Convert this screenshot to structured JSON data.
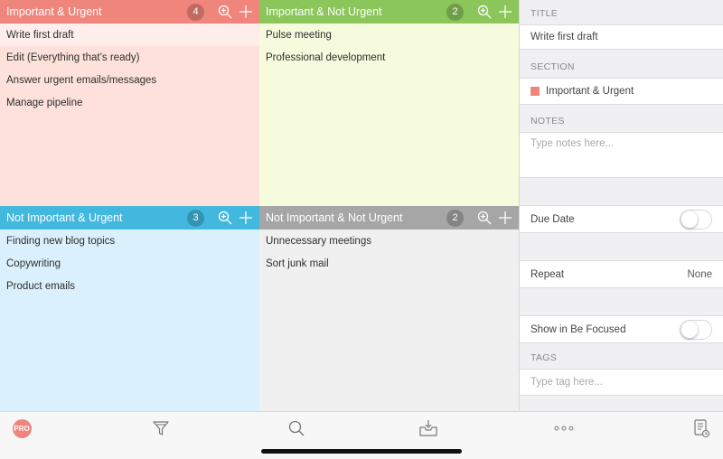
{
  "colors": {
    "important_urgent": "#f0857b",
    "important_urgent_bg": "#fde1da",
    "important_not_urgent": "#8bc65a",
    "important_not_urgent_bg": "#f5fbdc",
    "not_important_urgent": "#43b8df",
    "not_important_urgent_bg": "#daf0fc",
    "not_important_not_urgent": "#a6a6a6",
    "not_important_not_urgent_bg": "#f0f0f0"
  },
  "quadrants": {
    "iu": {
      "title": "Important & Urgent",
      "count": "4",
      "tasks": [
        "Write first draft",
        "Edit (Everything that’s ready)",
        "Answer urgent emails/messages",
        "Manage pipeline"
      ]
    },
    "inu": {
      "title": "Important & Not Urgent",
      "count": "2",
      "tasks": [
        "Pulse meeting",
        "Professional development"
      ]
    },
    "niu": {
      "title": "Not Important & Urgent",
      "count": "3",
      "tasks": [
        "Finding new blog topics",
        "Copywriting",
        "Product emails"
      ]
    },
    "ninu": {
      "title": "Not Important & Not Urgent",
      "count": "2",
      "tasks": [
        "Unnecessary meetings",
        "Sort junk mail"
      ]
    }
  },
  "detail": {
    "title_label": "TITLE",
    "title_value": "Write first draft",
    "section_label": "SECTION",
    "section_value": "Important & Urgent",
    "notes_label": "NOTES",
    "notes_placeholder": "Type notes here...",
    "due_date_label": "Due Date",
    "repeat_label": "Repeat",
    "repeat_value": "None",
    "focused_label": "Show in Be Focused",
    "tags_label": "TAGS",
    "tags_placeholder": "Type tag here..."
  },
  "toolbar": {
    "pro_label": "PRO",
    "icons": [
      "filter-icon",
      "search-icon",
      "inbox-icon",
      "more-icon",
      "notes-icon"
    ]
  }
}
